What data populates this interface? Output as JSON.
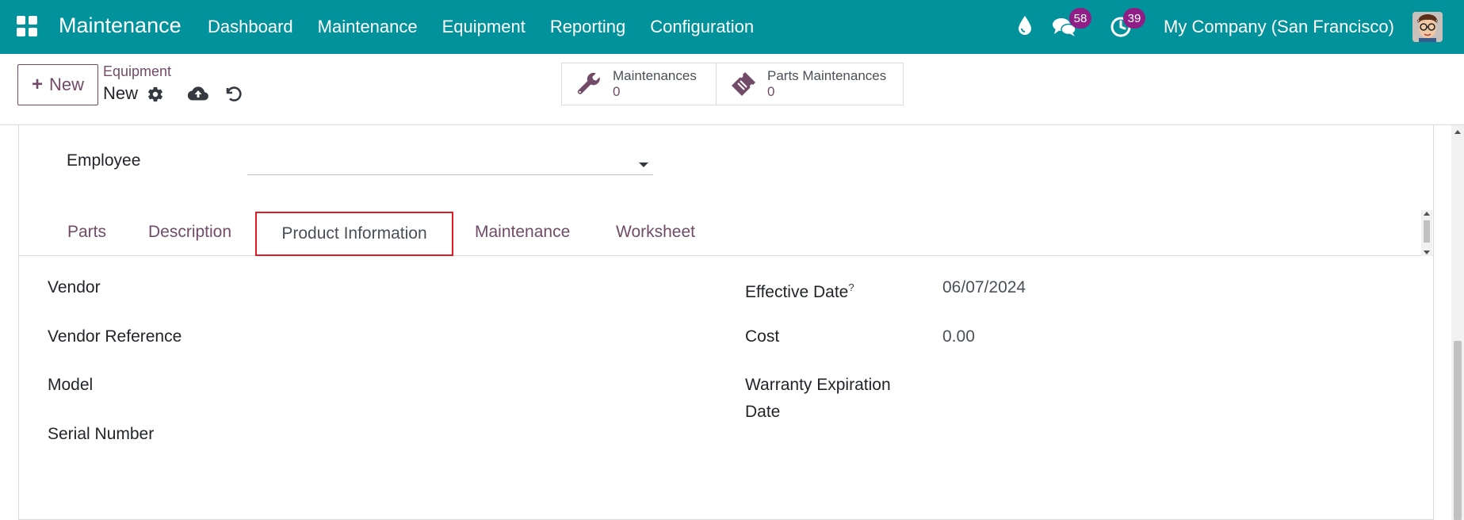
{
  "app": {
    "title": "Maintenance"
  },
  "nav": {
    "items": [
      "Dashboard",
      "Maintenance",
      "Equipment",
      "Reporting",
      "Configuration"
    ]
  },
  "systray": {
    "messages_count": "58",
    "activities_count": "39",
    "company": "My Company (San Francisco)"
  },
  "control": {
    "new_label": "New",
    "breadcrumb_parent": "Equipment",
    "breadcrumb_current": "New",
    "smart_buttons": [
      {
        "label": "Maintenances",
        "value": "0",
        "icon": "wrench-icon"
      },
      {
        "label": "Parts Maintenances",
        "value": "0",
        "icon": "ticket-icon"
      }
    ]
  },
  "form": {
    "employee_label": "Employee",
    "employee_value": "",
    "tabs": [
      "Parts",
      "Description",
      "Product Information",
      "Maintenance",
      "Worksheet"
    ],
    "active_tab": "Product Information",
    "left_fields": [
      {
        "label": "Vendor",
        "value": ""
      },
      {
        "label": "Vendor Reference",
        "value": ""
      },
      {
        "label": "Model",
        "value": ""
      },
      {
        "label": "Serial Number",
        "value": ""
      }
    ],
    "right_fields": [
      {
        "label": "Effective Date",
        "help": "?",
        "value": "06/07/2024"
      },
      {
        "label": "Cost",
        "value": "0.00"
      },
      {
        "label_line1": "Warranty Expiration",
        "label_line2": "Date",
        "value": ""
      }
    ]
  },
  "colors": {
    "navbar": "#01929b",
    "brand": "#714b67",
    "badge": "#8f1f87",
    "highlight": "#e01b24"
  }
}
